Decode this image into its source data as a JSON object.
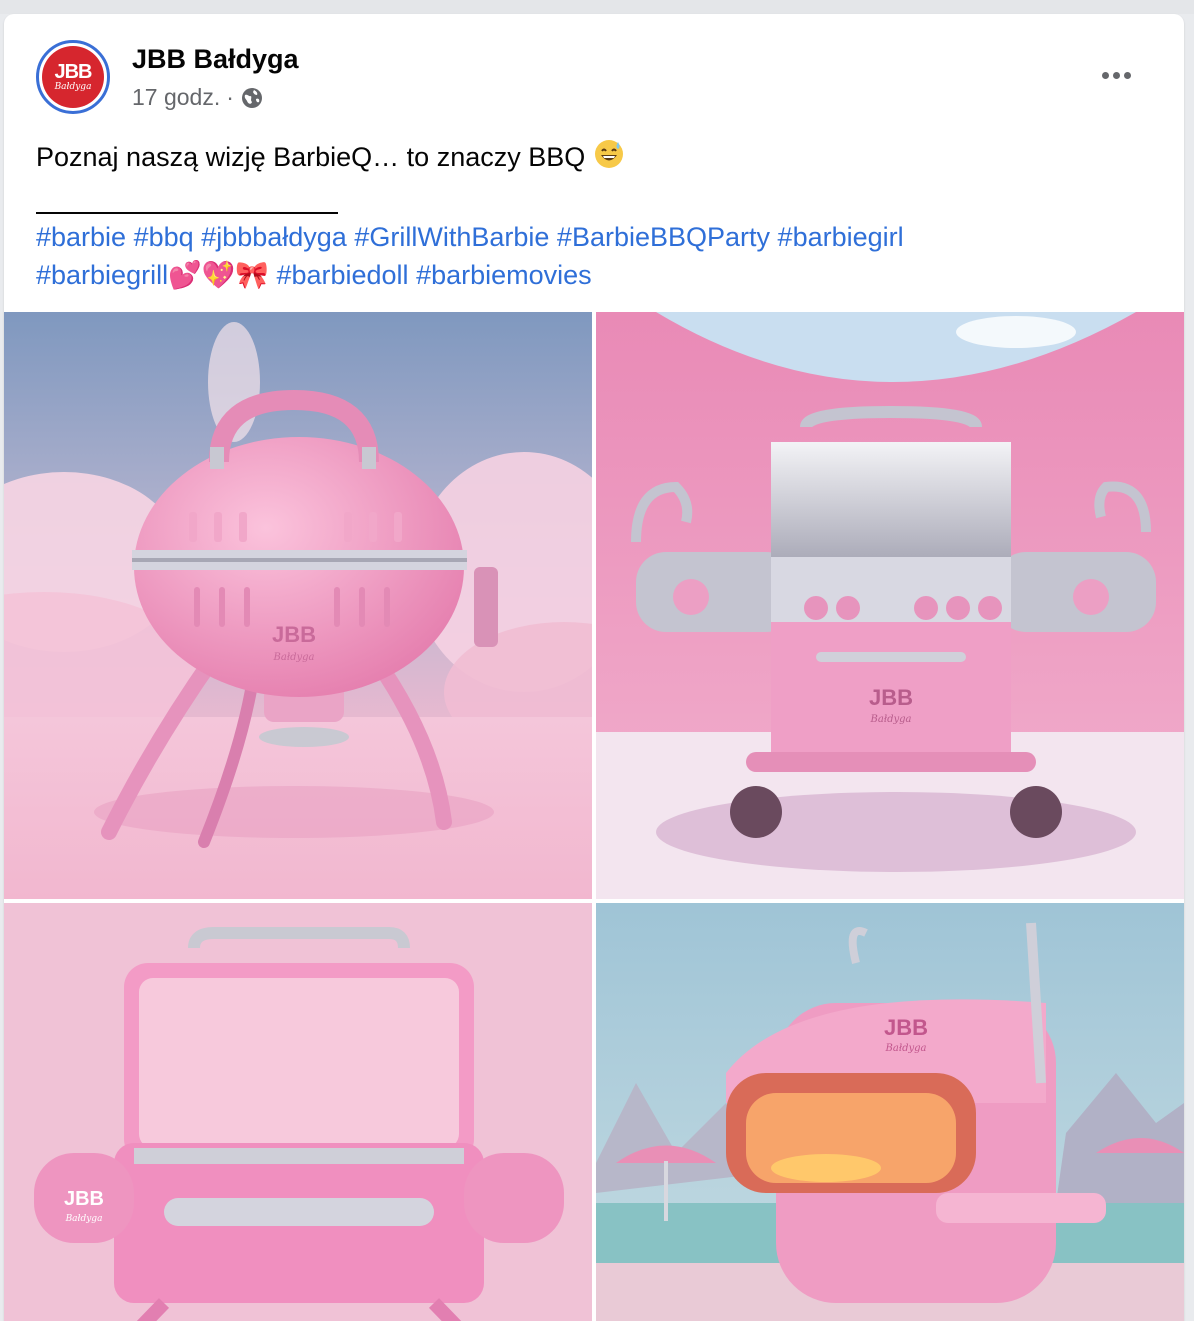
{
  "post": {
    "author": "JBB Bałdyga",
    "time": "17 godz.",
    "time_separator": "·",
    "avatar_text": "JBB",
    "avatar_script": "Bałdyga",
    "text_line1": "Poznaj naszą wizję BarbieQ… to znaczy BBQ",
    "hashtags_line1": [
      "#barbie",
      "#bbq",
      "#jbbbałdyga",
      "#GrillWithBarbie",
      "#BarbieBBQParty",
      "#barbiegirl"
    ],
    "hashtags_line2": [
      "#barbiegrill",
      "#barbiedoll",
      "#barbiemovies"
    ],
    "hashtag_emojis": "💕💖🎀"
  },
  "photos": [
    {
      "brand": "JBB",
      "brand_script": "Bałdyga"
    },
    {
      "brand": "JBB",
      "brand_script": "Bałdyga"
    },
    {
      "brand": "JBB",
      "brand_script": "Bałdyga"
    },
    {
      "brand": "JBB",
      "brand_script": "Bałdyga"
    }
  ],
  "colors": {
    "link": "#2f6fd8",
    "brand_red": "#d6262e",
    "pink": "#f29ac6"
  },
  "icons": {
    "privacy": "globe-icon",
    "more": "more-horizontal-icon",
    "emoji": "grinning-sweat-emoji"
  }
}
